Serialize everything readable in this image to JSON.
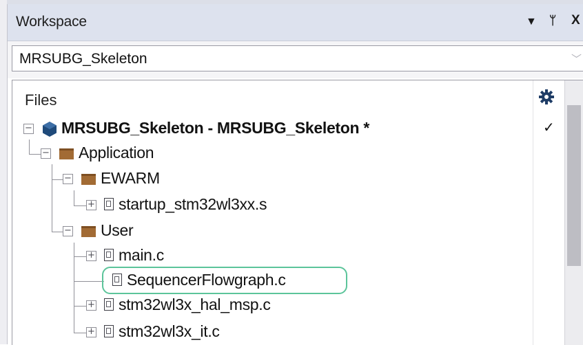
{
  "window": {
    "title": "Workspace",
    "controls": {
      "dropdown": "▼",
      "pin": "ᛘ",
      "close": "X"
    }
  },
  "config_combo": {
    "value": "MRSUBG_Skeleton"
  },
  "tree": {
    "header": "Files",
    "project": {
      "label": "MRSUBG_Skeleton - MRSUBG_Skeleton *",
      "status": "✓"
    },
    "items": [
      {
        "label": "Application",
        "type": "folder",
        "expander": "⊟"
      },
      {
        "label": "EWARM",
        "type": "folder",
        "expander": "⊟"
      },
      {
        "label": "startup_stm32wl3xx.s",
        "type": "asm-file",
        "expander": "⊞"
      },
      {
        "label": "User",
        "type": "folder",
        "expander": "⊟"
      },
      {
        "label": "main.c",
        "type": "c-file",
        "expander": "⊞"
      },
      {
        "label": "SequencerFlowgraph.c",
        "type": "c-file",
        "expander": ""
      },
      {
        "label": "stm32wl3x_hal_msp.c",
        "type": "c-file",
        "expander": "⊞"
      },
      {
        "label": "stm32wl3x_it.c",
        "type": "c-file",
        "expander": "⊞"
      }
    ],
    "highlighted_item": "SequencerFlowgraph.c"
  },
  "colors": {
    "titlebar": "#dde2ee",
    "folder": "#a26b34",
    "project_icon": "#1f4a7a",
    "highlight": "#5bc49a"
  }
}
